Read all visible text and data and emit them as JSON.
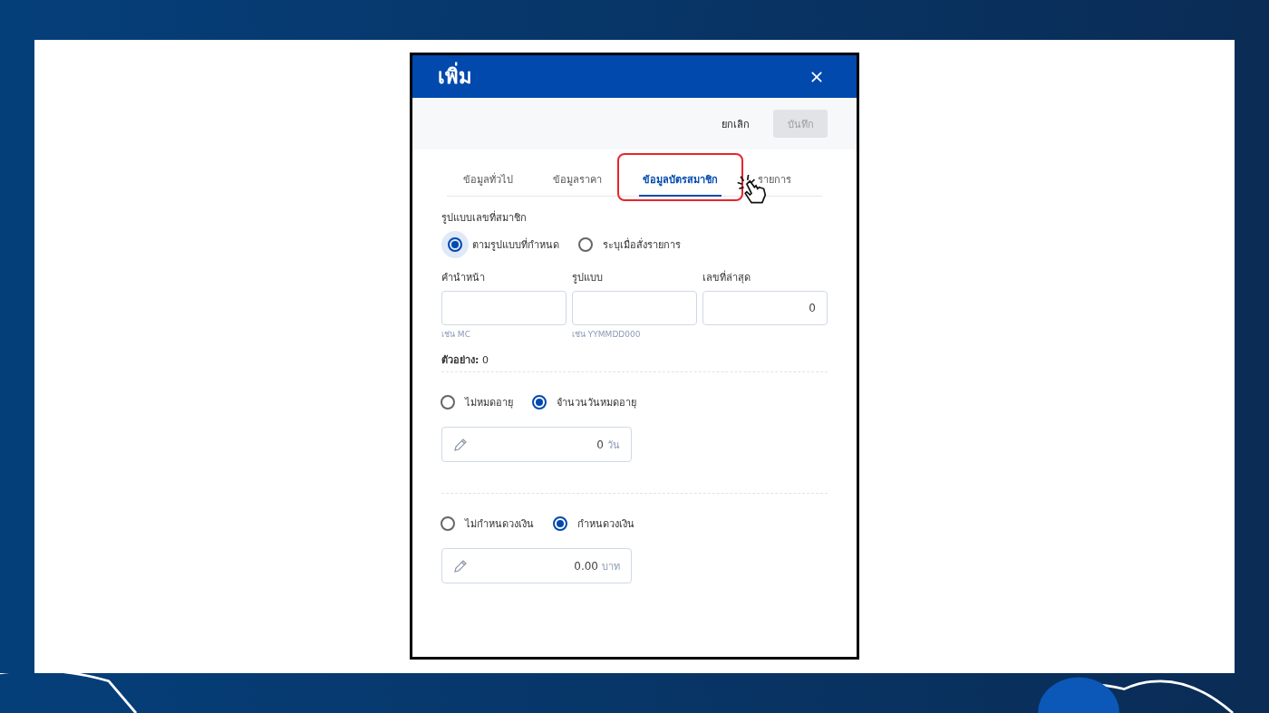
{
  "dialog": {
    "title": "เพิ่ม"
  },
  "actions": [
    {
      "label": "ยกเลิก",
      "kind": "text",
      "disabled": false
    },
    {
      "label": "บันทึก",
      "kind": "filled",
      "disabled": true
    }
  ],
  "tabs": [
    {
      "label": "ข้อมูลทั่วไป",
      "selected": false,
      "highlighted": false
    },
    {
      "label": "ข้อมูลราคา",
      "selected": false,
      "highlighted": false
    },
    {
      "label": "ข้อมูลบัตรสมาชิก",
      "selected": true,
      "highlighted": true
    },
    {
      "label": "รายการ",
      "selected": false,
      "highlighted": false
    }
  ],
  "member_number": {
    "label": "รูปแบบเลขที่สมาชิก",
    "options": [
      {
        "label": "ตามรูปแบบที่กำหนด",
        "selected": true
      },
      {
        "label": "ระบุเมื่อสั่งรายการ",
        "selected": false
      }
    ],
    "fields": [
      {
        "label": "คำนำหน้า",
        "hint": "เช่น MC"
      },
      {
        "label": "รูปแบบ",
        "hint": "เช่น YYMMDD000"
      },
      {
        "label": "เลขที่ล่าสุด",
        "value": "0"
      }
    ],
    "example": "**ตัวอย่าง:** 0"
  },
  "expiry": {
    "options": [
      {
        "label": "ไม่หมดอายุ",
        "selected": false
      },
      {
        "label": "จำนวนวันหมดอายุ",
        "selected": true
      }
    ],
    "value": "0",
    "unit": "วัน"
  },
  "budget": {
    "options": [
      {
        "label": "ไม่กำหนดวงเงิน",
        "selected": false
      },
      {
        "label": "กำหนดวงเงิน",
        "selected": true
      }
    ],
    "value": "0.00",
    "unit": "บาท"
  }
}
